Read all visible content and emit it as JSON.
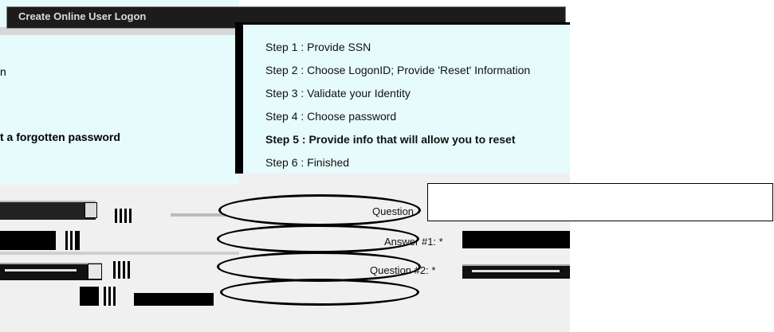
{
  "window": {
    "title": "Create Online User Logon"
  },
  "left_panel": {
    "text_1": "n",
    "text_2": "t a forgotten password"
  },
  "steps": [
    {
      "label": "Step 1 : Provide SSN",
      "current": false
    },
    {
      "label": "Step 2 : Choose LogonID; Provide 'Reset' Information",
      "current": false
    },
    {
      "label": "Step 3 : Validate your Identity",
      "current": false
    },
    {
      "label": "Step 4 : Choose password",
      "current": false
    },
    {
      "label": "Step 5 : Provide info that will allow you to reset",
      "current": true
    },
    {
      "label": "Step 6 : Finished",
      "current": false
    }
  ],
  "form": {
    "question_1_label": "Question",
    "answer_1_label": "Answer #1: *",
    "question_2_label": "Question #2: *"
  },
  "colors": {
    "panel_bg": "#e6fbfb",
    "form_bg": "#f0f0f0",
    "ink": "#000000"
  }
}
